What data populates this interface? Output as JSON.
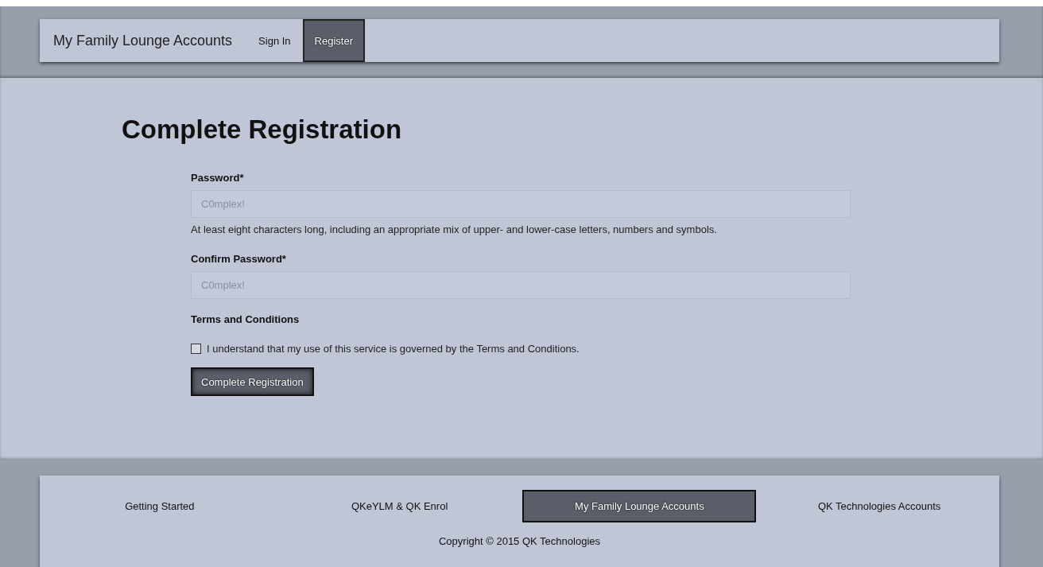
{
  "navbar": {
    "brand": "My Family Lounge Accounts",
    "links": [
      {
        "label": "Sign In",
        "selected": false
      },
      {
        "label": "Register",
        "selected": true
      }
    ]
  },
  "page": {
    "title": "Complete Registration",
    "fields": [
      {
        "label": "Password*",
        "placeholder": "C0mplex!",
        "help": "At least eight characters long, including an appropriate mix of upper- and lower-case letters, numbers and symbols."
      },
      {
        "label": "Confirm Password*",
        "placeholder": "C0mplex!"
      }
    ],
    "terms": {
      "heading": "Terms and Conditions",
      "checkbox": {
        "label": "I understand that my use of this service is governed by the Terms and Conditions.",
        "checked": false
      }
    },
    "submit": "Complete Registration"
  },
  "footer": {
    "links": [
      {
        "label": "Getting Started",
        "selected": false
      },
      {
        "label": "QKeYLM & QK Enrol",
        "selected": false
      },
      {
        "label": "My Family Lounge Accounts",
        "selected": true
      },
      {
        "label": "QK Technologies Accounts",
        "selected": false
      }
    ],
    "copyright": "Copyright © 2015 QK Technologies"
  }
}
